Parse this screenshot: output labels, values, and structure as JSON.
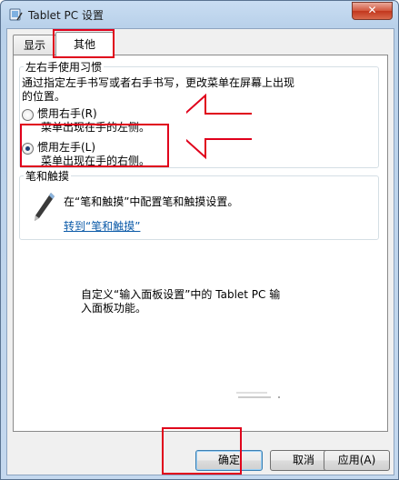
{
  "window": {
    "title": "Tablet PC 设置",
    "close_symbol": "✕"
  },
  "tabs": [
    {
      "label": "显示",
      "selected": false
    },
    {
      "label": "其他",
      "selected": true
    }
  ],
  "handedness": {
    "legend": "左右手使用习惯",
    "description_line1": "通过指定左手书写或者右手书写，更改菜单在屏幕上出现",
    "description_line2": "的位置。",
    "options": [
      {
        "label": "惯用右手(R)",
        "sublabel": "菜单出现在手的左侧。",
        "checked": false
      },
      {
        "label": "惯用左手(L)",
        "sublabel": "菜单出现在手的右侧。",
        "checked": true
      }
    ]
  },
  "pen_touch": {
    "legend": "笔和触摸",
    "text": "在“笔和触摸”中配置笔和触摸设置。",
    "link": "转到“笔和触摸”",
    "icon": "pen-icon"
  },
  "input_panel": {
    "line1": "自定义“输入面板设置”中的 Tablet PC 输",
    "line2": "入面板功能。"
  },
  "buttons": {
    "ok": "确定",
    "cancel": "取消",
    "apply": "应用(A)"
  },
  "annotation_color": "#e0001b"
}
